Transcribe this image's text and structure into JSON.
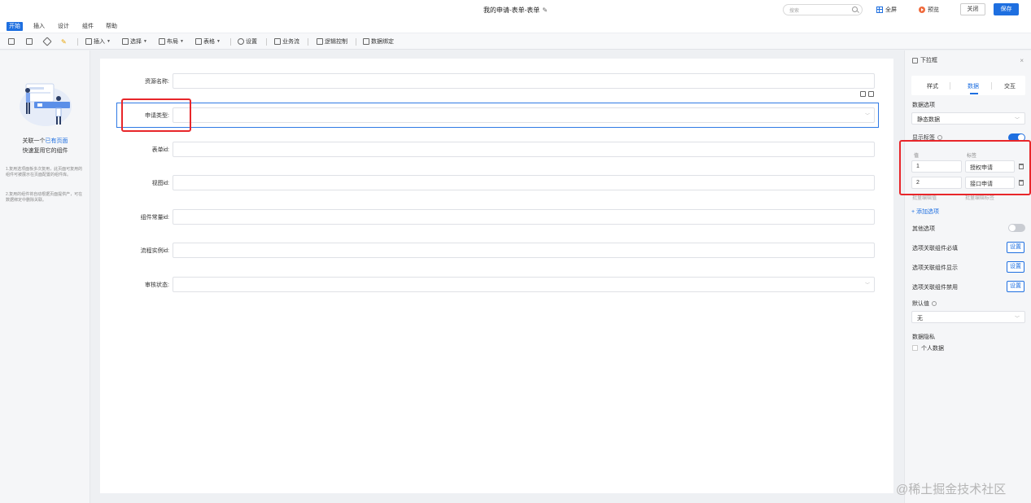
{
  "header": {
    "title": "我的申请-表单-表单",
    "search_placeholder": "搜索",
    "fullscreen_label": "全屏",
    "preview_label": "预览",
    "close_label": "关闭",
    "save_label": "保存"
  },
  "menu": {
    "tabs": [
      "开始",
      "插入",
      "设计",
      "组件",
      "帮助"
    ],
    "active_tab": "开始"
  },
  "toolbar": {
    "insert": "插入",
    "select": "选择",
    "layout": "布局",
    "table": "表格",
    "settings": "设置",
    "workflow": "业务流",
    "logic_control": "逻辑控制",
    "data_binding": "数据绑定"
  },
  "left_panel": {
    "line1_prefix": "关联一个",
    "line1_link": "已有页面",
    "line2": "快速复用它的组件",
    "note1": "1.复用选项面板多次复用，此页面可复用的组件可被展示在页面配置的组件库。",
    "note2": "2.复用的组件将自动根据页面提供产，可在数据绑定中删除关联。"
  },
  "form": {
    "fields": [
      {
        "label": "资源名称:",
        "type": "text"
      },
      {
        "label": "申请类型:",
        "type": "select"
      },
      {
        "label": "表单id:",
        "type": "text"
      },
      {
        "label": "视图id:",
        "type": "text"
      },
      {
        "label": "组件常量id:",
        "type": "text"
      },
      {
        "label": "流程实例id:",
        "type": "text"
      },
      {
        "label": "审核状态:",
        "type": "select"
      }
    ]
  },
  "right_panel": {
    "component_title": "下拉框",
    "tabs": [
      "样式",
      "数据",
      "交互"
    ],
    "active_tab": "数据",
    "data_options_label": "数据选项",
    "data_source_value": "静态数据",
    "show_label_label": "显示标签",
    "show_label_on": true,
    "option_value_header": "值",
    "option_label_header": "标签",
    "options": [
      {
        "value": "1",
        "label": "授权申请"
      },
      {
        "value": "2",
        "label": "接口申请"
      }
    ],
    "hint_left": "批量编辑值",
    "hint_right": "批量编辑标签",
    "add_option_label": "+ 添加选项",
    "other_option_label": "其他选项",
    "other_option_on": false,
    "option_required_label": "选项关联组件必填",
    "option_show_label": "选项关联组件显示",
    "option_disable_label": "选项关联组件禁用",
    "set_label": "设置",
    "default_value_label": "默认值",
    "default_value": "无",
    "data_privacy_label": "数据隐私",
    "personal_data_label": "个人数据"
  },
  "watermark": "@稀土掘金技术社区",
  "colors": {
    "primary": "#1e6fe0",
    "highlight_red": "#e8262a",
    "preview_orange": "#f06a3c"
  }
}
